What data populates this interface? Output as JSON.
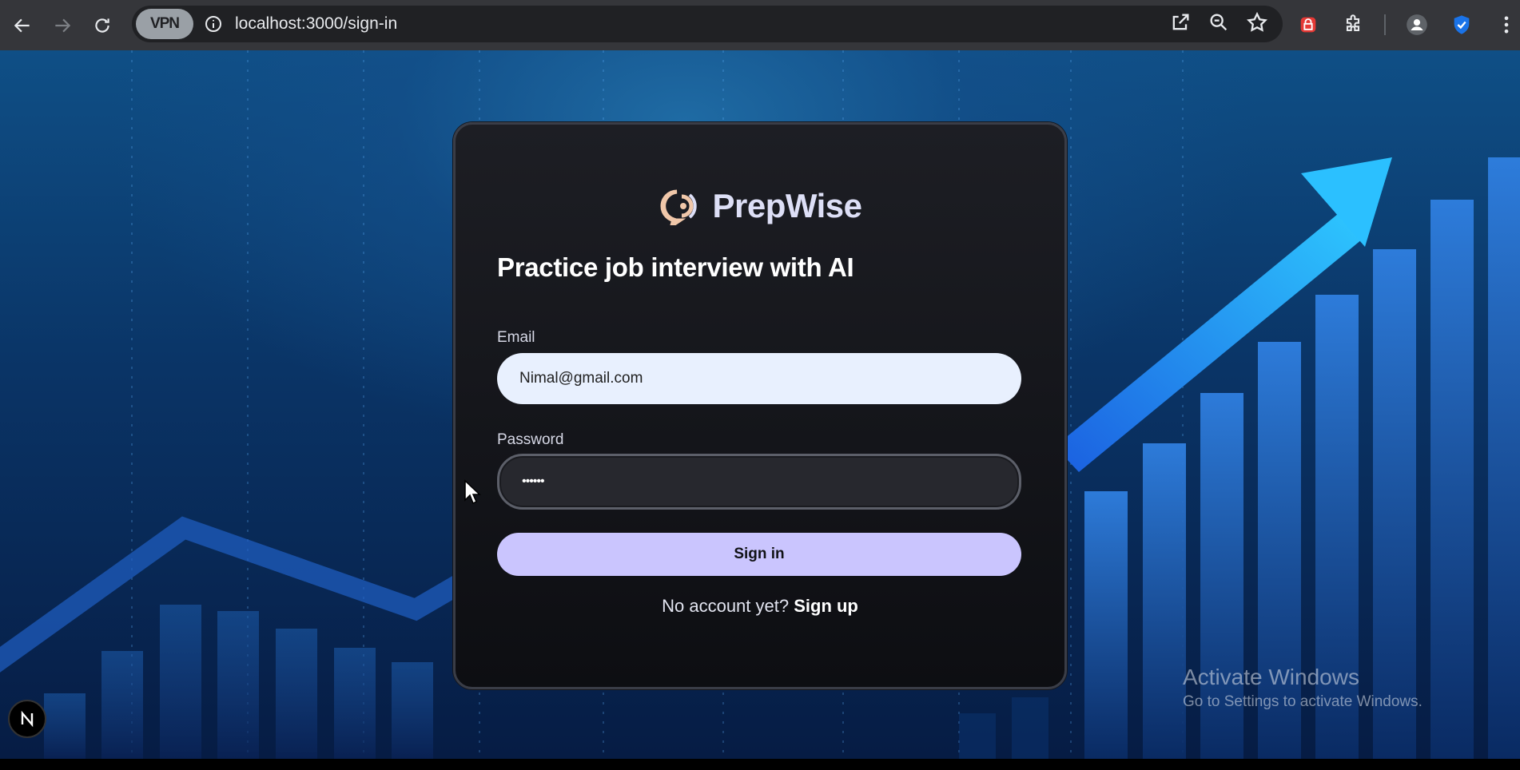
{
  "browser": {
    "url": "localhost:3000/sign-in",
    "vpn_label": "VPN"
  },
  "auth": {
    "brand": "PrepWise",
    "heading": "Practice job interview with AI",
    "email_label": "Email",
    "email_value": "Nimal@gmail.com",
    "password_label": "Password",
    "password_value": "••••••",
    "submit_label": "Sign in",
    "footer_text": "No account yet?",
    "footer_link": "Sign up"
  },
  "watermark": {
    "title": "Activate Windows",
    "subtitle": "Go to Settings to activate Windows."
  },
  "colors": {
    "accent": "#cac5fe",
    "card": "#0d0e12",
    "chart_blue": "#2f8bff"
  }
}
